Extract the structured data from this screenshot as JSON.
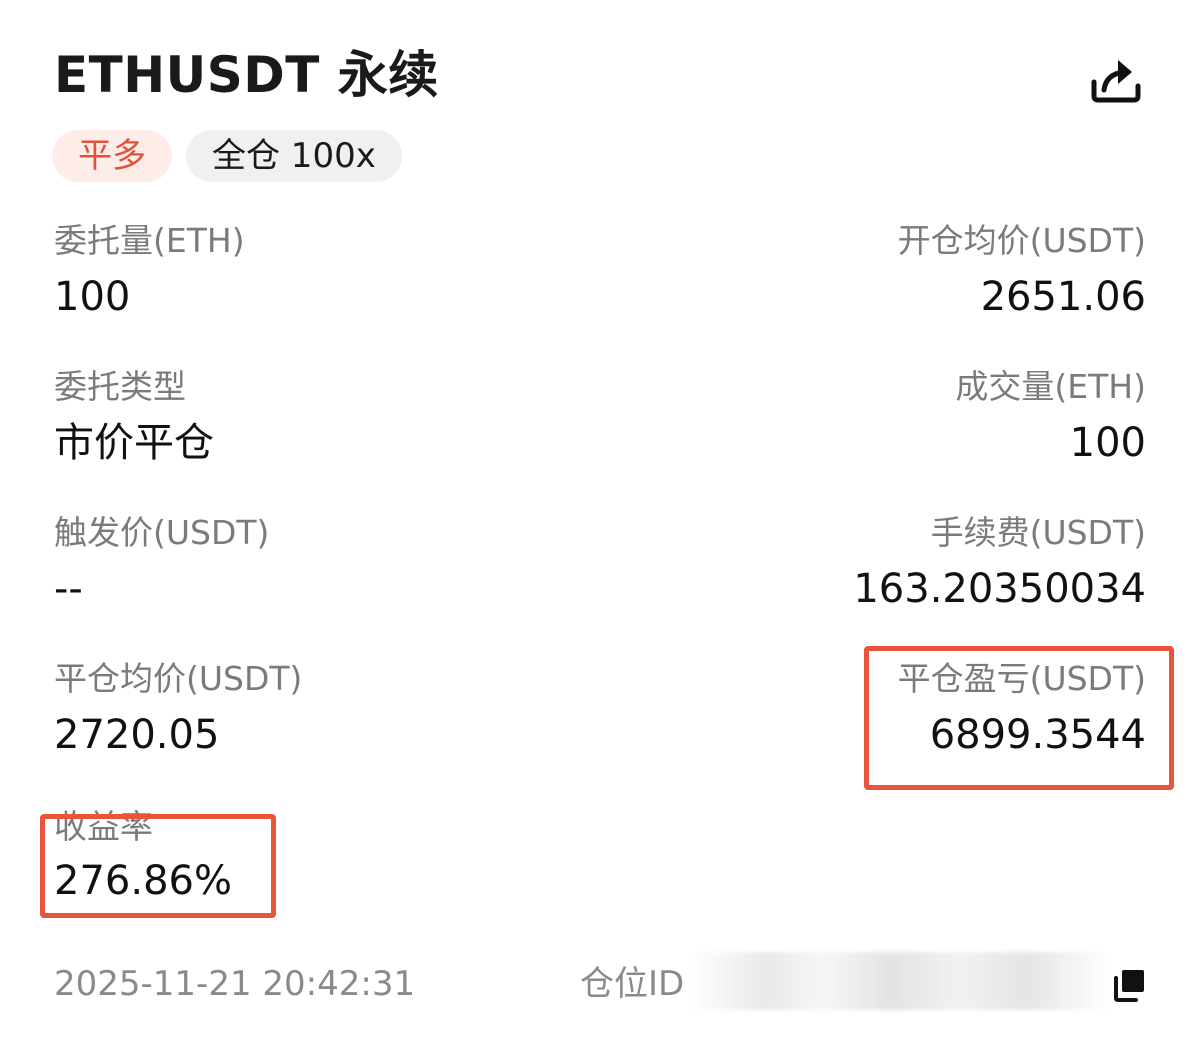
{
  "header": {
    "title": "ETHUSDT 永续",
    "share_icon": "share-icon"
  },
  "tags": {
    "side": "平多",
    "margin": "全仓 100x"
  },
  "fields": {
    "order_qty": {
      "label": "委托量(ETH)",
      "value": "100"
    },
    "open_avg": {
      "label": "开仓均价(USDT)",
      "value": "2651.06"
    },
    "order_type": {
      "label": "委托类型",
      "value": "市价平仓"
    },
    "filled_qty": {
      "label": "成交量(ETH)",
      "value": "100"
    },
    "trigger": {
      "label": "触发价(USDT)",
      "value": "--"
    },
    "fee": {
      "label": "手续费(USDT)",
      "value": "163.20350034"
    },
    "close_avg": {
      "label": "平仓均价(USDT)",
      "value": "2720.05"
    },
    "close_pnl": {
      "label": "平仓盈亏(USDT)",
      "value": "6899.3544"
    },
    "roi": {
      "label": "收益率",
      "value": "276.86%"
    }
  },
  "footer": {
    "timestamp": "2025-11-21 20:42:31",
    "position_id_label": "仓位ID",
    "copy_icon": "copy-icon"
  },
  "colors": {
    "accent_side": "#e0533a",
    "highlight_border": "#e8553c",
    "label_gray": "#7b7b7b"
  }
}
